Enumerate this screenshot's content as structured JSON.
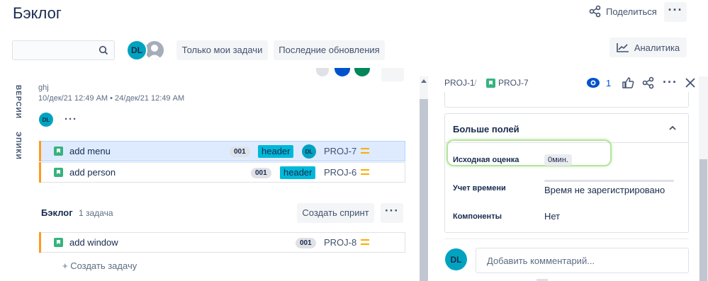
{
  "page": {
    "title": "Бэклог",
    "share_label": "Поделиться"
  },
  "toolbar": {
    "search_placeholder": "",
    "avatar_initials": "DL",
    "filter_mine": "Только мои задачи",
    "filter_recent": "Последние обновления",
    "analytics": "Аналитика"
  },
  "sidebar_tabs": {
    "versions": "ВЕРСИИ",
    "epics": "ЭПИКИ"
  },
  "sprint": {
    "name": "ghj",
    "dates": "10/дек/21 12:49 AM • 24/дек/21 12:49 AM",
    "avatar_initials": "DL",
    "issues": [
      {
        "summary": "add menu",
        "points": "001",
        "epic": "header",
        "assignee": "DL",
        "key": "PROJ-7"
      },
      {
        "summary": "add person",
        "points": "001",
        "epic": "header",
        "key": "PROJ-6"
      }
    ]
  },
  "backlog": {
    "title": "Бэклог",
    "count": "1 задача",
    "create_sprint": "Создать спринт",
    "issues": [
      {
        "summary": "add window",
        "points": "001",
        "key": "PROJ-8"
      }
    ],
    "create_task": "+  Создать задачу"
  },
  "detail": {
    "breadcrumb_parent": "PROJ-1",
    "breadcrumb_sep": "/",
    "breadcrumb_key": "PROJ-7",
    "watchers": "1",
    "more_fields_title": "Больше полей",
    "fields": {
      "estimate_label": "Исходная оценка",
      "estimate_value": "0мин.",
      "time_label": "Учет времени",
      "time_value": "Время не зарегистрировано",
      "components_label": "Компоненты",
      "components_value": "Нет"
    },
    "comment_avatar": "DL",
    "comment_placeholder": "Добавить комментарий..."
  },
  "colors": {
    "epic": "#00b8d9",
    "story": "#36b37e",
    "priority": "#ffab00",
    "selected": "#deebff",
    "highlight": "#b6e3a0"
  }
}
